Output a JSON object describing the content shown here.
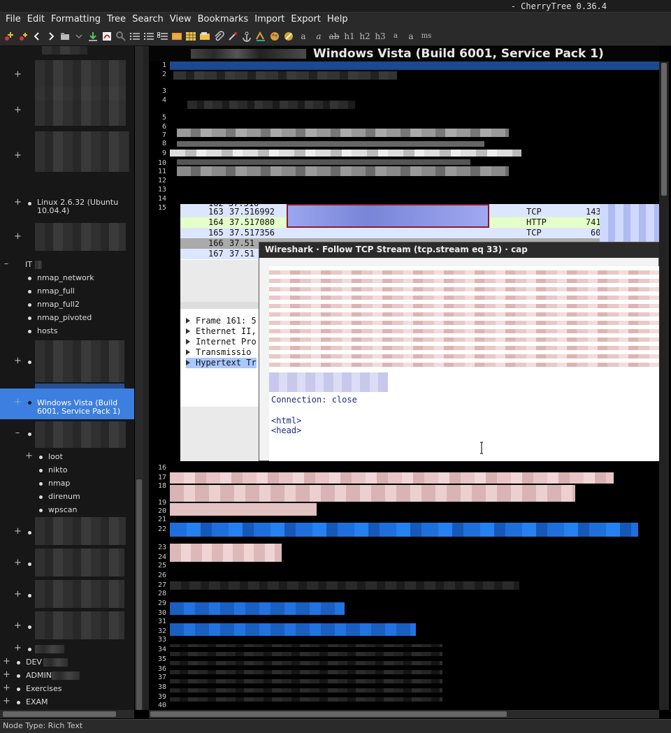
{
  "window": {
    "title": "CherryTree 0.36.4"
  },
  "menu": [
    "File",
    "Edit",
    "Formatting",
    "Tree",
    "Search",
    "View",
    "Bookmarks",
    "Import",
    "Export",
    "Help"
  ],
  "toolbar": {
    "text_buttons": [
      "a",
      "a",
      "ab",
      "h1",
      "h2",
      "h3",
      "a",
      "a",
      "ms"
    ]
  },
  "tree": {
    "nodes": [
      {
        "label": "Linux 2.6.32 (Ubuntu 10.04.4)",
        "expander": "+"
      },
      {
        "label": "IT",
        "expander": "–"
      },
      {
        "label": "nmap_network"
      },
      {
        "label": "nmap_full"
      },
      {
        "label": "nmap_full2"
      },
      {
        "label": "nmap_pivoted"
      },
      {
        "label": "hosts"
      },
      {
        "label": "Windows Vista (Build 6001, Service Pack 1)",
        "expander": "+",
        "selected": true
      },
      {
        "label": "loot",
        "expander": "+"
      },
      {
        "label": "nikto"
      },
      {
        "label": "nmap"
      },
      {
        "label": "direnum"
      },
      {
        "label": "wpscan"
      },
      {
        "label": "DEV",
        "expander": "+"
      },
      {
        "label": "ADMIN",
        "expander": "+"
      },
      {
        "label": "Exercises",
        "expander": "+"
      },
      {
        "label": "EXAM",
        "expander": "+"
      }
    ]
  },
  "editor": {
    "node_title": "Windows Vista (Build 6001, Service Pack 1)",
    "line_numbers": [
      "1",
      "2",
      "3",
      "4",
      "5",
      "6",
      "7",
      "8",
      "9",
      "10",
      "11",
      "12",
      "13",
      "14",
      "15",
      "16",
      "17",
      "18",
      "19",
      "20",
      "21",
      "22",
      "23",
      "24",
      "25",
      "26",
      "27",
      "28",
      "29",
      "30",
      "31",
      "32",
      "33",
      "34",
      "35",
      "36",
      "37",
      "38",
      "39",
      "40"
    ]
  },
  "wireshark": {
    "packets": [
      {
        "no": "163",
        "time": "37.516992",
        "proto": "TCP",
        "len": "143"
      },
      {
        "no": "164",
        "time": "37.517080",
        "proto": "HTTP",
        "len": "741"
      },
      {
        "no": "165",
        "time": "37.517356",
        "proto": "TCP",
        "len": "60"
      },
      {
        "no": "166",
        "time": "37.51"
      },
      {
        "no": "167",
        "time": "37.51"
      }
    ],
    "details": [
      "Frame 161: 5",
      "Ethernet II,",
      "Internet Pro",
      "Transmissio",
      "Hypertext Tr"
    ],
    "dialog_title": "Wireshark · Follow TCP Stream (tcp.stream eq 33) · cap",
    "stream_lines": [
      "Connection: close",
      "<html>",
      "<head>"
    ]
  },
  "status": {
    "text": "Node Type: Rich Text"
  },
  "colors": {
    "selection": "#3d7fe0",
    "line1_highlight": "#1a4a8f",
    "http_row": "#e4ffc7",
    "stream_text": "#1d2a8a"
  }
}
